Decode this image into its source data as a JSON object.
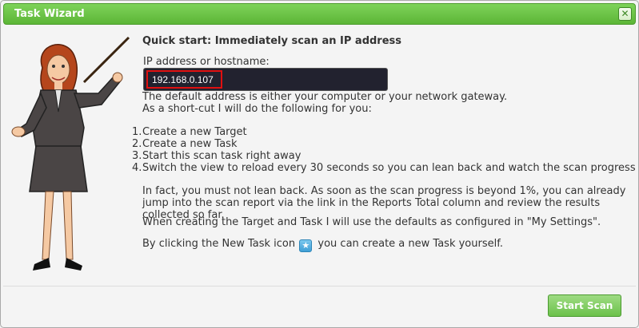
{
  "window": {
    "title": "Task Wizard",
    "close_icon": "close-icon"
  },
  "wizard": {
    "heading": "Quick start: Immediately scan an IP address",
    "ip_label": "IP address or hostname:",
    "ip_value": "192.168.0.107",
    "default_note": "The default address is either your computer or your network gateway.",
    "shortcut_note": "As a short-cut I will do the following for you:",
    "steps": [
      {
        "num": "1.",
        "text": "Create a new Target"
      },
      {
        "num": "2.",
        "text": "Create a new Task"
      },
      {
        "num": "3.",
        "text": "Start this scan task right away"
      },
      {
        "num": "4.",
        "text": "Switch the view to reload every 30 seconds so you can lean back and watch the scan progress"
      }
    ],
    "lean_back": "In fact, you must not lean back. As soon as the scan progress is beyond 1%, you can already jump into the scan report via the link in the Reports Total column and review the results collected so far.",
    "defaults_note": "When creating the Target and Task I will use the defaults as configured in \"My Settings\".",
    "new_task_before": "By clicking the New Task icon",
    "new_task_icon": "new-task-star-icon",
    "new_task_after": "you can create a new Task yourself."
  },
  "footer": {
    "start_label": "Start Scan"
  },
  "colors": {
    "titlebar": "#6cc447",
    "start_button": "#7ccb5a",
    "ip_field_bg": "#22222f",
    "ip_highlight": "#e01010"
  }
}
